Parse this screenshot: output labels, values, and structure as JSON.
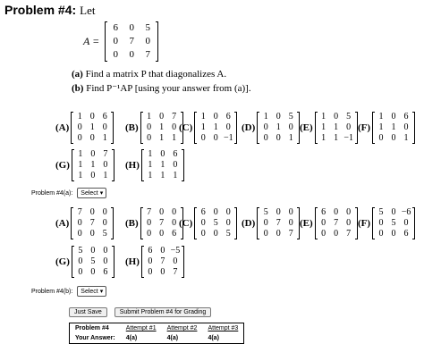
{
  "problem": {
    "title_bold": "Problem #4:",
    "title_rest": "Let",
    "matrix_name": "A =",
    "matrix": [
      [
        "6",
        "0",
        "5"
      ],
      [
        "0",
        "7",
        "0"
      ],
      [
        "0",
        "0",
        "7"
      ]
    ],
    "parts": [
      {
        "label": "(a)",
        "text": "Find a matrix P that diagonalizes A."
      },
      {
        "label": "(b)",
        "text": "Find P⁻¹AP [using your answer from (a)]."
      }
    ]
  },
  "part_a": {
    "options": [
      {
        "label": "(A)",
        "m": [
          [
            "1",
            "0",
            "6"
          ],
          [
            "0",
            "1",
            "0"
          ],
          [
            "0",
            "0",
            "1"
          ]
        ]
      },
      {
        "label": "(B)",
        "m": [
          [
            "1",
            "0",
            "7"
          ],
          [
            "0",
            "1",
            "0"
          ],
          [
            "0",
            "1",
            "1"
          ]
        ]
      },
      {
        "label": "(C)",
        "m": [
          [
            "1",
            "0",
            "6"
          ],
          [
            "1",
            "1",
            "0"
          ],
          [
            "0",
            "0",
            "−1"
          ]
        ]
      },
      {
        "label": "(D)",
        "m": [
          [
            "1",
            "0",
            "5"
          ],
          [
            "0",
            "1",
            "0"
          ],
          [
            "0",
            "0",
            "1"
          ]
        ]
      },
      {
        "label": "(E)",
        "m": [
          [
            "1",
            "0",
            "5"
          ],
          [
            "1",
            "1",
            "0"
          ],
          [
            "1",
            "1",
            "−1"
          ]
        ]
      },
      {
        "label": "(F)",
        "m": [
          [
            "1",
            "0",
            "6"
          ],
          [
            "1",
            "1",
            "0"
          ],
          [
            "0",
            "0",
            "1"
          ]
        ]
      },
      {
        "label": "(G)",
        "m": [
          [
            "1",
            "0",
            "7"
          ],
          [
            "1",
            "1",
            "0"
          ],
          [
            "1",
            "0",
            "1"
          ]
        ]
      },
      {
        "label": "(H)",
        "m": [
          [
            "1",
            "0",
            "6"
          ],
          [
            "1",
            "1",
            "0"
          ],
          [
            "1",
            "1",
            "1"
          ]
        ]
      }
    ],
    "answer_label": "Problem #4(a):",
    "select_value": "Select ▾"
  },
  "part_b": {
    "options": [
      {
        "label": "(A)",
        "m": [
          [
            "7",
            "0",
            "0"
          ],
          [
            "0",
            "7",
            "0"
          ],
          [
            "0",
            "0",
            "5"
          ]
        ]
      },
      {
        "label": "(B)",
        "m": [
          [
            "7",
            "0",
            "0"
          ],
          [
            "0",
            "7",
            "0"
          ],
          [
            "0",
            "0",
            "6"
          ]
        ]
      },
      {
        "label": "(C)",
        "m": [
          [
            "6",
            "0",
            "0"
          ],
          [
            "0",
            "5",
            "0"
          ],
          [
            "0",
            "0",
            "5"
          ]
        ]
      },
      {
        "label": "(D)",
        "m": [
          [
            "5",
            "0",
            "0"
          ],
          [
            "0",
            "7",
            "0"
          ],
          [
            "0",
            "0",
            "7"
          ]
        ]
      },
      {
        "label": "(E)",
        "m": [
          [
            "6",
            "0",
            "0"
          ],
          [
            "0",
            "7",
            "0"
          ],
          [
            "0",
            "0",
            "7"
          ]
        ]
      },
      {
        "label": "(F)",
        "m": [
          [
            "5",
            "0",
            "−6"
          ],
          [
            "0",
            "5",
            "0"
          ],
          [
            "0",
            "0",
            "6"
          ]
        ]
      },
      {
        "label": "(G)",
        "m": [
          [
            "5",
            "0",
            "0"
          ],
          [
            "0",
            "5",
            "0"
          ],
          [
            "0",
            "0",
            "6"
          ]
        ]
      },
      {
        "label": "(H)",
        "m": [
          [
            "6",
            "0",
            "−5"
          ],
          [
            "0",
            "7",
            "0"
          ],
          [
            "0",
            "0",
            "7"
          ]
        ]
      }
    ],
    "answer_label": "Problem #4(b):",
    "select_value": "Select ▾"
  },
  "buttons": {
    "save": "Just Save",
    "submit": "Submit Problem #4 for Grading"
  },
  "attempts": {
    "headers": [
      "Problem #4",
      "Attempt #1",
      "Attempt #2",
      "Attempt #3"
    ],
    "row": [
      "Your Answer:",
      "4(a)",
      "4(a)",
      "4(a)"
    ]
  }
}
